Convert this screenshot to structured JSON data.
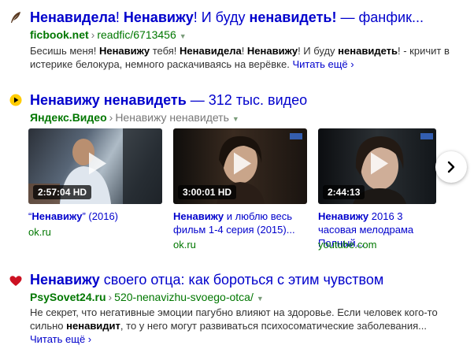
{
  "results": [
    {
      "title_parts": [
        {
          "t": "Ненавидела",
          "b": true
        },
        {
          "t": "! ",
          "b": false
        },
        {
          "t": "Ненавижу",
          "b": true
        },
        {
          "t": "! И буду ",
          "b": false
        },
        {
          "t": "ненавидеть!",
          "b": true
        },
        {
          "t": " — фанфик...",
          "b": false
        }
      ],
      "domain": "ficbook.net",
      "path": "readfic/6713456",
      "snippet_parts": [
        {
          "t": "Бесишь меня! ",
          "b": false
        },
        {
          "t": "Ненавижу",
          "b": true
        },
        {
          "t": " тебя! ",
          "b": false
        },
        {
          "t": "Ненавидела",
          "b": true
        },
        {
          "t": "! ",
          "b": false
        },
        {
          "t": "Ненавижу",
          "b": true
        },
        {
          "t": "! И буду ",
          "b": false
        },
        {
          "t": "ненавидеть",
          "b": true
        },
        {
          "t": "! - кричит в истерике белокура, немного раскачиваясь на верёвке.",
          "b": false
        }
      ],
      "more": "Читать ещё ›"
    },
    {
      "title_parts": [
        {
          "t": "Ненавижу ненавидеть",
          "b": true
        },
        {
          "t": " — 312 тыс. видео",
          "b": false
        }
      ],
      "domain": "Яндекс.Видео",
      "path": "Ненавижу ненавидеть",
      "videos": [
        {
          "duration": "2:57:04 HD",
          "caption_parts": [
            {
              "t": "“",
              "b": false
            },
            {
              "t": "Ненавижу",
              "b": true
            },
            {
              "t": "” (2016)",
              "b": false
            }
          ],
          "source": "ok.ru"
        },
        {
          "duration": "3:00:01 HD",
          "caption_parts": [
            {
              "t": "Ненавижу",
              "b": true
            },
            {
              "t": " и люблю весь фильм 1-4 серия (2015)...",
              "b": false
            }
          ],
          "source": "ok.ru"
        },
        {
          "duration": "2:44:13",
          "caption_parts": [
            {
              "t": "Ненавижу",
              "b": true
            },
            {
              "t": " 2016 3 часовая мелодрама Полный...",
              "b": false
            }
          ],
          "source": "youtube.com"
        }
      ]
    },
    {
      "title_parts": [
        {
          "t": "Ненавижу",
          "b": true
        },
        {
          "t": " своего отца: как бороться с этим чувством",
          "b": false
        }
      ],
      "domain": "PsySovet24.ru",
      "path": "520-nenavizhu-svoego-otca/",
      "snippet_parts": [
        {
          "t": "Не секрет, что негативные эмоции пагубно влияют на здоровье. Если человек кого-то сильно ",
          "b": false
        },
        {
          "t": "ненавидит",
          "b": true
        },
        {
          "t": ", то у него могут развиваться психосоматические заболевания...",
          "b": false
        }
      ],
      "more": "Читать ещё ›"
    }
  ],
  "icons": {
    "r1": "quill-feather-icon",
    "r2": "play-circle-icon",
    "r3": "heart-icon",
    "next": "chevron-right-icon"
  },
  "colors": {
    "title_link": "#0000cc",
    "url_green": "#007700",
    "snippet_text": "#333333",
    "play_yellow": "#ffcc00",
    "heart_red": "#cc1122"
  }
}
